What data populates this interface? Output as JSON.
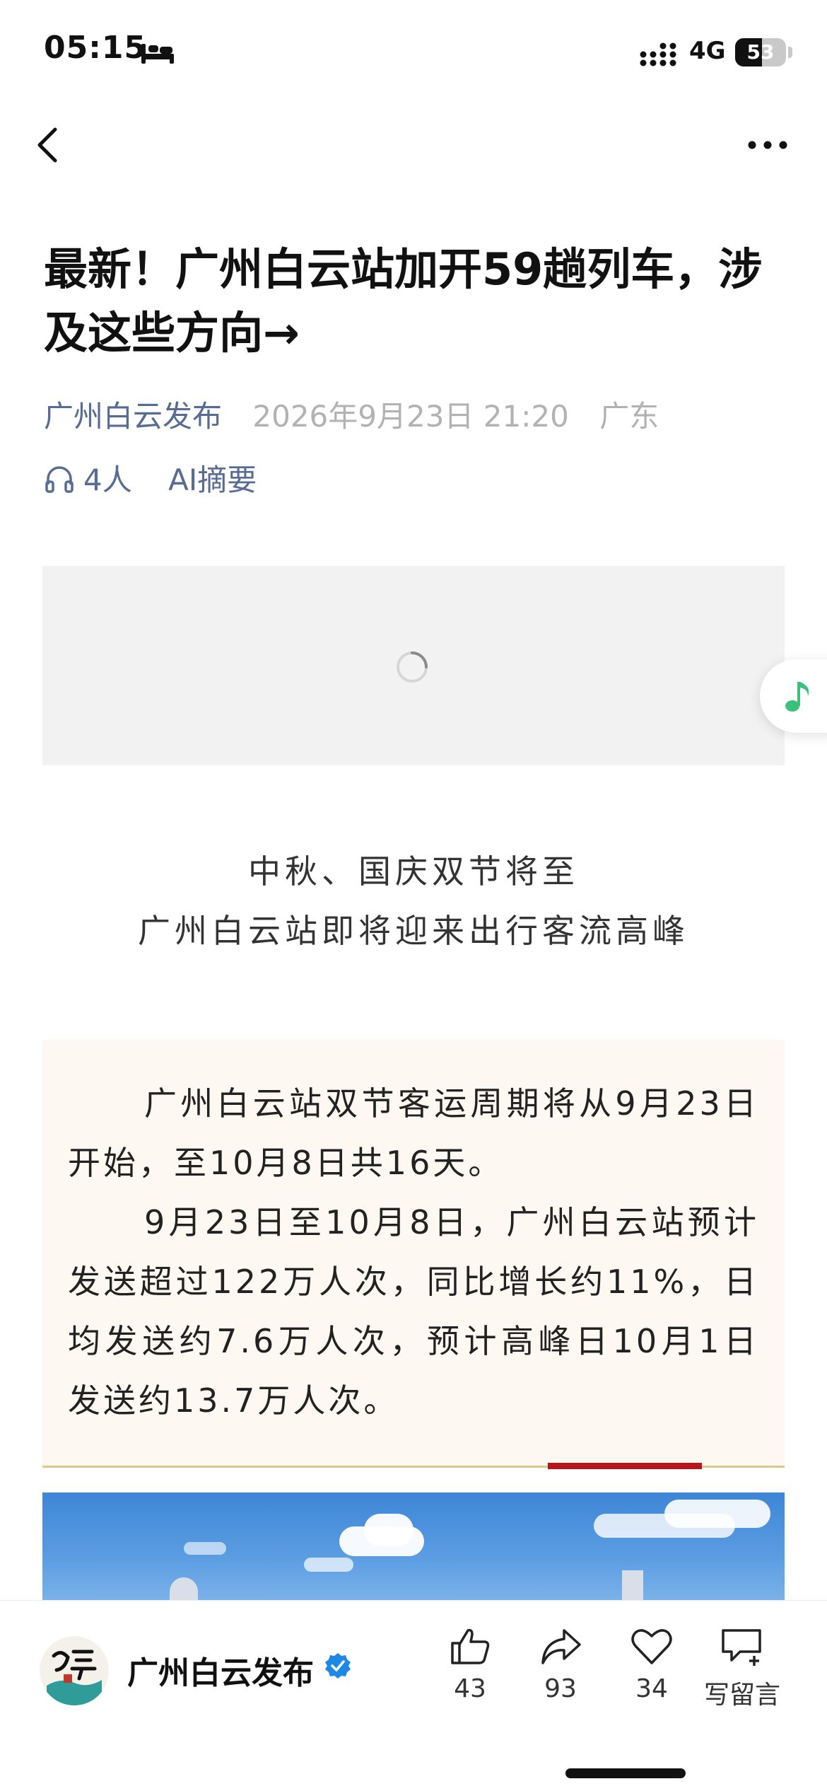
{
  "status_bar": {
    "time": "05:15",
    "network": "4G",
    "battery_level": "53",
    "battery_fraction": 0.53
  },
  "nav": {
    "back_icon": "chevron-left-icon",
    "more_icon": "more-dots-icon"
  },
  "article": {
    "title": "最新！广州白云站加开59趟列车，涉及这些方向→",
    "author": "广州白云发布",
    "publish_time": "2026年9月23日 21:20",
    "region": "广东",
    "listen_count": "4人",
    "ai_summary": "AI摘要",
    "intro_lines": [
      "中秋、国庆双节将至",
      "广州白云站即将迎来出行客流高峰"
    ],
    "info_paragraphs": [
      "广州白云站双节客运周期将从9月23日开始，至10月8日共16天。",
      "9月23日至10月8日，广州白云站预计发送超过122万人次，同比增长约11%，日均发送约7.6万人次，预计高峰日10月1日发送约13.7万人次。"
    ]
  },
  "bottom_bar": {
    "account_name": "广州白云发布",
    "actions": [
      {
        "icon": "thumbs-up-icon",
        "label": "43"
      },
      {
        "icon": "share-arrow-icon",
        "label": "93"
      },
      {
        "icon": "heart-icon",
        "label": "34"
      },
      {
        "icon": "comment-plus-icon",
        "label": "写留言"
      }
    ]
  },
  "colors": {
    "link": "#576b95",
    "muted": "#b2b2b2",
    "box_bg": "#fdf8f1",
    "accent_red": "#b8141c",
    "music_green": "#3cc17a",
    "verified_blue": "#1e88e5"
  }
}
